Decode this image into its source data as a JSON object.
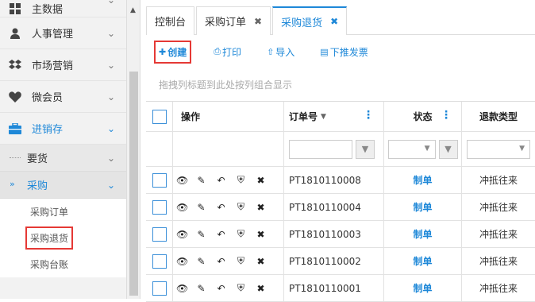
{
  "sidebar": {
    "items": [
      {
        "label": "主数据",
        "icon": "grid-icon"
      },
      {
        "label": "人事管理",
        "icon": "user-icon"
      },
      {
        "label": "市场营销",
        "icon": "dropbox-icon"
      },
      {
        "label": "微会员",
        "icon": "heart-icon"
      },
      {
        "label": "进销存",
        "icon": "briefcase-icon"
      }
    ],
    "sub_items": [
      {
        "label": "要货"
      },
      {
        "label": "采购"
      }
    ],
    "leaf_items": [
      {
        "label": "采购订单"
      },
      {
        "label": "采购退货"
      },
      {
        "label": "采购台账"
      }
    ]
  },
  "tabs": [
    {
      "label": "控制台"
    },
    {
      "label": "采购订单"
    },
    {
      "label": "采购退货"
    }
  ],
  "toolbar": {
    "create": "创建",
    "print": "打印",
    "import": "导入",
    "push_down": "下推发票"
  },
  "group_hint": "拖拽列标题到此处按列组合显示",
  "table": {
    "headers": [
      "操作",
      "订单号",
      "状态",
      "退款类型"
    ],
    "rows": [
      {
        "order": "PT1810110008",
        "status": "制单",
        "refund_type": "冲抵往来"
      },
      {
        "order": "PT1810110004",
        "status": "制单",
        "refund_type": "冲抵往来"
      },
      {
        "order": "PT1810110003",
        "status": "制单",
        "refund_type": "冲抵往来"
      },
      {
        "order": "PT1810110002",
        "status": "制单",
        "refund_type": "冲抵往来"
      },
      {
        "order": "PT1810110001",
        "status": "制单",
        "refund_type": "冲抵往来"
      }
    ]
  },
  "colors": {
    "accent": "#1e88d8",
    "highlight": "#e53935"
  }
}
